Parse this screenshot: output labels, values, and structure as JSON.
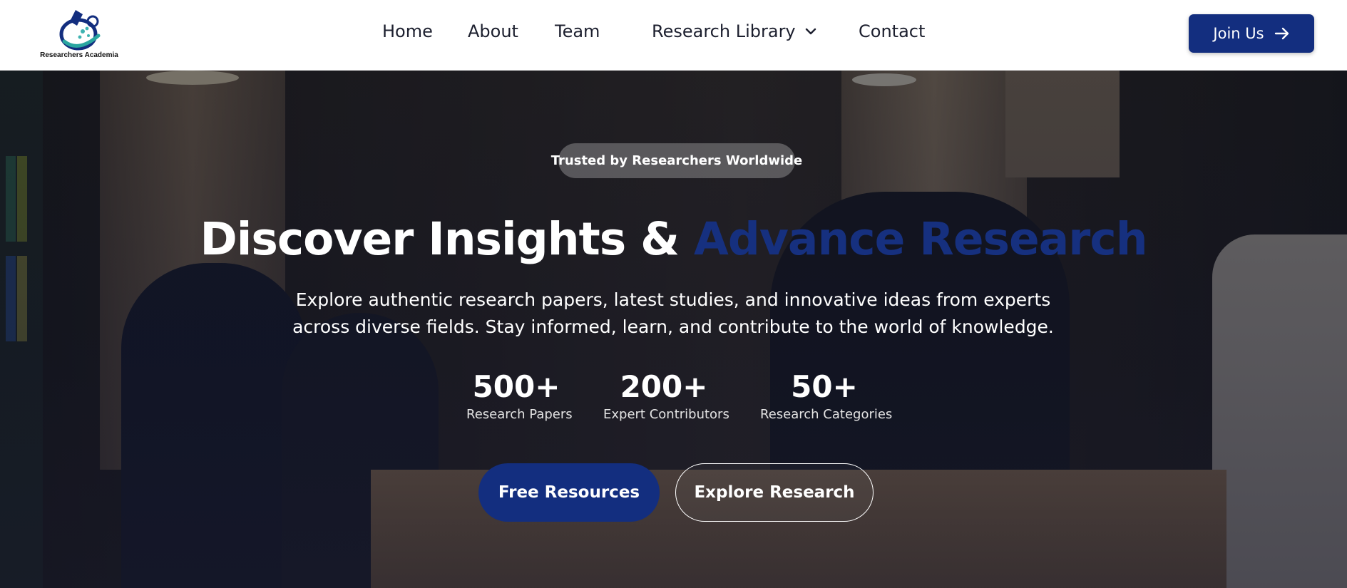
{
  "brand": {
    "name": "Researchers Academia",
    "logo_icon": "microscope-globe-logo",
    "primary_color": "#132e7f"
  },
  "nav": {
    "items": [
      {
        "label": "Home"
      },
      {
        "label": "About"
      },
      {
        "label": "Team"
      },
      {
        "label": "Research Library",
        "icon": "chevron-down-icon"
      },
      {
        "label": "Contact"
      }
    ],
    "cta": {
      "label": "Join Us",
      "icon": "arrow-right-icon"
    }
  },
  "hero": {
    "badge": "Trusted by Researchers Worldwide",
    "headline_main": "Discover Insights &",
    "headline_accent": "Advance Research",
    "accent_color": "#16307f",
    "description": "Explore authentic research papers, latest studies, and innovative ideas from experts across diverse fields. Stay informed, learn, and contribute to the world of knowledge.",
    "stats": [
      {
        "value": "500+",
        "label": "Research Papers"
      },
      {
        "value": "200+",
        "label": "Expert Contributors"
      },
      {
        "value": "50+",
        "label": "Research Categories"
      }
    ],
    "buttons": {
      "primary": "Free Resources",
      "secondary": "Explore Research"
    }
  }
}
